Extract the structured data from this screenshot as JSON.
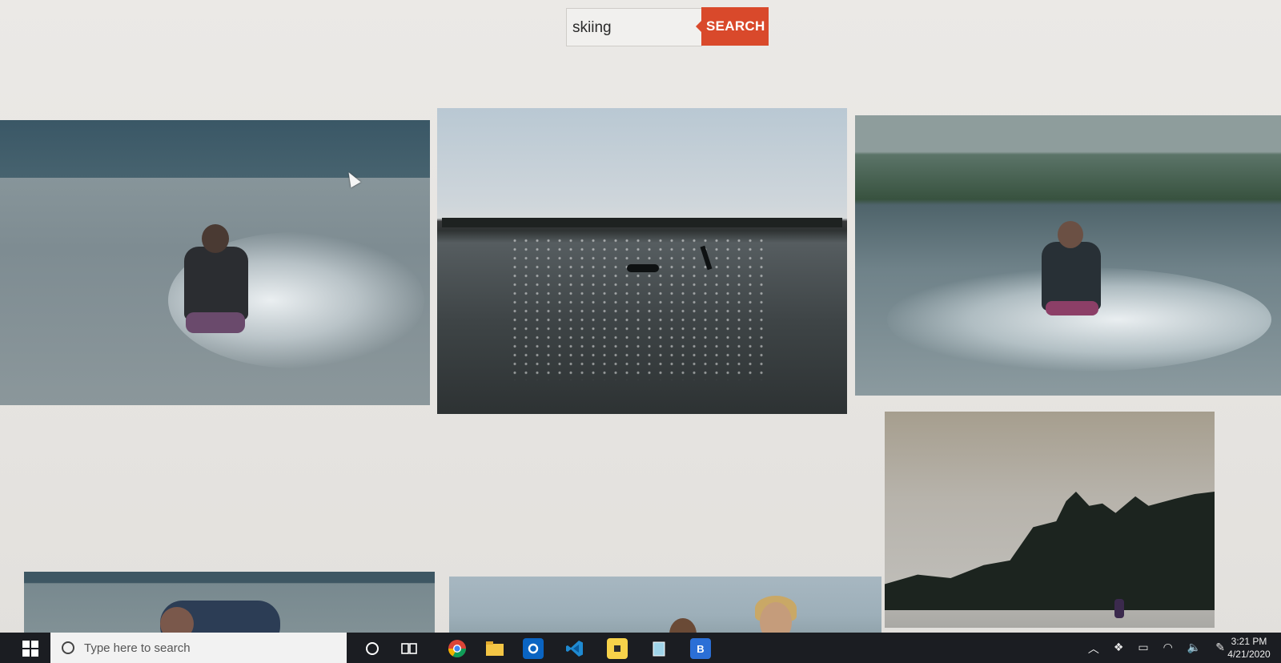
{
  "search": {
    "value": "skiing",
    "button_label": "SEARCH"
  },
  "results": [
    {
      "name": "result-image-1",
      "alt": ""
    },
    {
      "name": "result-image-2",
      "alt": ""
    },
    {
      "name": "result-image-3",
      "alt": ""
    },
    {
      "name": "result-image-4",
      "alt": ""
    },
    {
      "name": "result-image-5",
      "alt": ""
    },
    {
      "name": "result-image-6",
      "alt": ""
    }
  ],
  "taskbar": {
    "search_placeholder": "Type here to search",
    "apps": [
      {
        "icon": "task-view-icon"
      },
      {
        "icon": "chrome-icon"
      },
      {
        "icon": "file-explorer-icon"
      },
      {
        "icon": "outlook-icon"
      },
      {
        "icon": "vscode-icon"
      },
      {
        "icon": "sticky-notes-icon"
      },
      {
        "icon": "notepad-icon"
      },
      {
        "icon": "b-app-icon",
        "label": "B"
      }
    ],
    "tray_icons": [
      "chevron-up-icon",
      "dropbox-icon",
      "battery-icon",
      "wifi-icon",
      "volume-icon",
      "pen-icon"
    ],
    "clock": {
      "time": "3:21 PM",
      "date": "4/21/2020"
    }
  },
  "colors": {
    "search_button": "#d9492b",
    "taskbar": "#1b1d22",
    "background": "#e9e7e3"
  }
}
